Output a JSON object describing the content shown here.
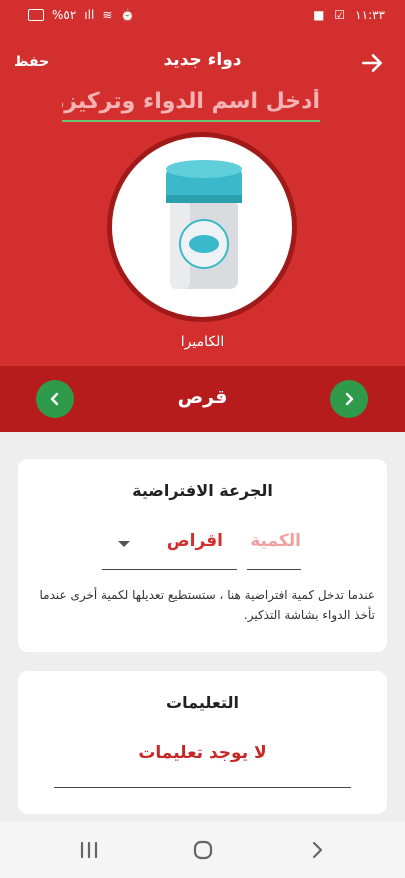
{
  "status": {
    "battery": "%٥٢",
    "time": "١١:٣٣"
  },
  "header": {
    "title": "دواء جديد",
    "save_label": "حفظ",
    "name_placeholder": "أدخل اسم الدواء وتركيزه",
    "camera_label": "الكاميرا"
  },
  "type_selector": {
    "value": "قرص"
  },
  "default_dose": {
    "title": "الجرعة الافتراضية",
    "quantity_placeholder": "الكمية",
    "unit_value": "اقراص",
    "note": "عندما تدخل كمية افتراضية هنا ، ستستطيع تعديلها لكمية أخرى عندما تأخذ الدواء بشاشة التذكير."
  },
  "instructions": {
    "title": "التعليمات",
    "value": "لا يوجد تعليمات"
  },
  "colors": {
    "primary": "#d32f2f",
    "dark": "#b71c1c",
    "accent_green": "#2e9a4a",
    "bottle_cap": "#3bb8c9"
  },
  "icons": [
    "back-arrow-icon",
    "camera-photo",
    "chevron-left-icon",
    "chevron-right-icon",
    "dropdown-icon",
    "recents-icon",
    "home-icon",
    "back-icon"
  ]
}
